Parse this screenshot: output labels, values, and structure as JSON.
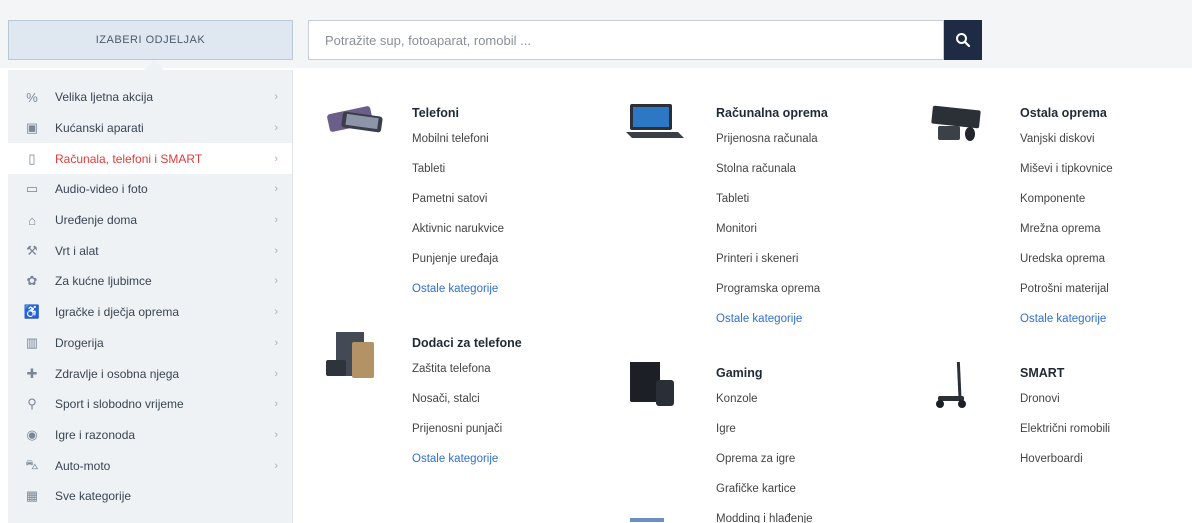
{
  "header": {
    "departments_label": "IZABERI ODJELJAK",
    "search_placeholder": "Potražite sup, fotoaparat, romobil ..."
  },
  "menu": [
    {
      "label": "Velika ljetna akcija",
      "icon": "percent-icon",
      "glyph": "%"
    },
    {
      "label": "Kućanski aparati",
      "icon": "appliance-icon",
      "glyph": "▣"
    },
    {
      "label": "Računala, telefoni i SMART",
      "icon": "phone-icon",
      "glyph": "▯",
      "active": true
    },
    {
      "label": "Audio-video i foto",
      "icon": "monitor-icon",
      "glyph": "▭"
    },
    {
      "label": "Uređenje doma",
      "icon": "home-icon",
      "glyph": "⌂"
    },
    {
      "label": "Vrt i alat",
      "icon": "tools-icon",
      "glyph": "⚒"
    },
    {
      "label": "Za kućne ljubimce",
      "icon": "pet-icon",
      "glyph": "✿"
    },
    {
      "label": "Igračke i dječja oprema",
      "icon": "stroller-icon",
      "glyph": "♿"
    },
    {
      "label": "Drogerija",
      "icon": "bottle-icon",
      "glyph": "▥"
    },
    {
      "label": "Zdravlje i osobna njega",
      "icon": "health-icon",
      "glyph": "✚"
    },
    {
      "label": "Sport i slobodno vrijeme",
      "icon": "bicycle-icon",
      "glyph": "⚲"
    },
    {
      "label": "Igre i razonoda",
      "icon": "gamepad-icon",
      "glyph": "◉"
    },
    {
      "label": "Auto-moto",
      "icon": "car-icon",
      "glyph": "⛍"
    },
    {
      "label": "Sve kategorije",
      "icon": "grid-icon",
      "glyph": "▦"
    }
  ],
  "categories": {
    "telefoni": {
      "title": "Telefoni",
      "links": [
        "Mobilni telefoni",
        "Tableti",
        "Pametni satovi",
        "Aktivnic narukvice",
        "Punjenje uređaja"
      ],
      "more": "Ostale kategorije"
    },
    "dodaci": {
      "title": "Dodaci za telefone",
      "links": [
        "Zaštita telefona",
        "Nosači, stalci",
        "Prijenosni punjači"
      ],
      "more": "Ostale kategorije"
    },
    "racunalna": {
      "title": "Računalna oprema",
      "links": [
        "Prijenosna računala",
        "Stolna računala",
        "Tableti",
        "Monitori",
        "Printeri i skeneri",
        "Programska oprema"
      ],
      "more": "Ostale kategorije"
    },
    "gaming": {
      "title": "Gaming",
      "links": [
        "Konzole",
        "Igre",
        "Oprema za igre",
        "Grafičke kartice",
        "Modding i hlađenje"
      ]
    },
    "ostala": {
      "title": "Ostala oprema",
      "links": [
        "Vanjski diskovi",
        "Miševi i tipkovnice",
        "Komponente",
        "Mrežna oprema",
        "Uredska oprema",
        "Potrošni materijal"
      ],
      "more": "Ostale kategorije"
    },
    "smart": {
      "title": "SMART",
      "links": [
        "Dronovi",
        "Električni romobili",
        "Hoverboardi"
      ]
    }
  },
  "colors": {
    "active_menu": "#e23b3b",
    "link_more": "#2f6fd1",
    "search_button": "#1d2b45"
  }
}
